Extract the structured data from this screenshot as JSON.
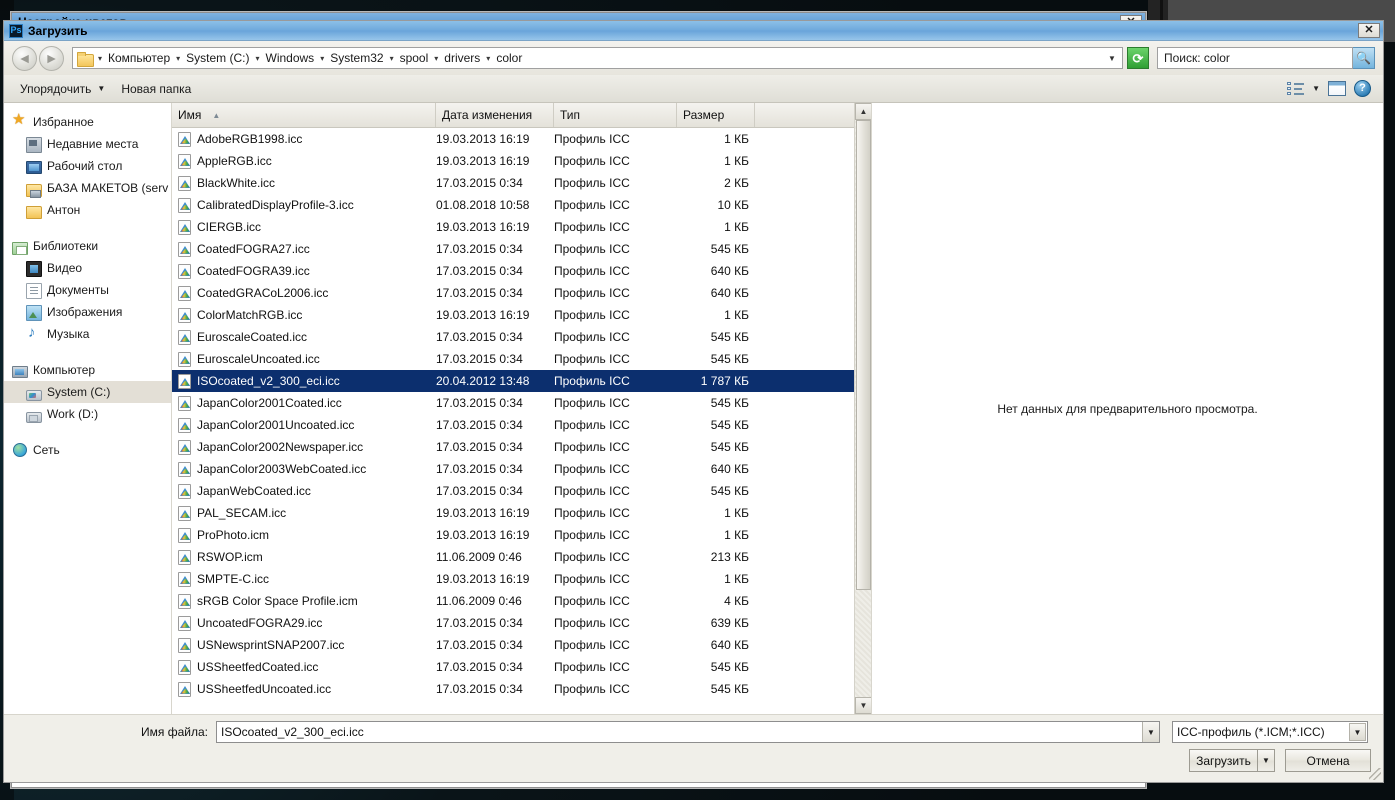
{
  "outer_window": {
    "title": "Настройка цветов",
    "close_label": "✕"
  },
  "dialog": {
    "title": "Загрузить",
    "app_icon": "Ps",
    "close_label": "✕"
  },
  "nav": {
    "back_icon": "◄",
    "forward_icon": "►",
    "folder_icon": "folder-icon",
    "breadcrumb": [
      "Компьютер",
      "System (C:)",
      "Windows",
      "System32",
      "spool",
      "drivers",
      "color"
    ],
    "separator": "▾",
    "refresh_icon": "⟳",
    "search_value": "Поиск: color",
    "search_icon": "🔍"
  },
  "toolbar": {
    "organize_label": "Упорядочить",
    "new_folder_label": "Новая папка",
    "caret": "▼",
    "views_icon": "views-icon",
    "preview_pane_icon": "preview-pane-icon",
    "help_icon": "?"
  },
  "sidebar": {
    "groups": [
      {
        "header": {
          "label": "Избранное",
          "icon": "star"
        },
        "items": [
          {
            "label": "Недавние места",
            "icon": "recent"
          },
          {
            "label": "Рабочий стол",
            "icon": "desktop-i"
          },
          {
            "label": "БАЗА МАКЕТОВ (serv",
            "icon": "netfolder"
          },
          {
            "label": "Антон",
            "icon": "folder-y"
          }
        ]
      },
      {
        "header": {
          "label": "Библиотеки",
          "icon": "library"
        },
        "items": [
          {
            "label": "Видео",
            "icon": "video"
          },
          {
            "label": "Документы",
            "icon": "docs"
          },
          {
            "label": "Изображения",
            "icon": "pics"
          },
          {
            "label": "Музыка",
            "icon": "music"
          }
        ]
      },
      {
        "header": {
          "label": "Компьютер",
          "icon": "computer"
        },
        "items": [
          {
            "label": "System (C:)",
            "icon": "drive-c",
            "selected": true
          },
          {
            "label": "Work (D:)",
            "icon": "drive-d"
          }
        ]
      },
      {
        "header": {
          "label": "Сеть",
          "icon": "network"
        },
        "items": []
      }
    ]
  },
  "filelist": {
    "columns": [
      {
        "label": "Имя",
        "sorted": true,
        "sort_arrow": "▲"
      },
      {
        "label": "Дата изменения"
      },
      {
        "label": "Тип"
      },
      {
        "label": "Размер"
      },
      {
        "label": ""
      }
    ],
    "rows": [
      {
        "name": "AdobeRGB1998.icc",
        "date": "19.03.2013 16:19",
        "type": "Профиль ICC",
        "size": "1 КБ"
      },
      {
        "name": "AppleRGB.icc",
        "date": "19.03.2013 16:19",
        "type": "Профиль ICC",
        "size": "1 КБ"
      },
      {
        "name": "BlackWhite.icc",
        "date": "17.03.2015 0:34",
        "type": "Профиль ICC",
        "size": "2 КБ"
      },
      {
        "name": "CalibratedDisplayProfile-3.icc",
        "date": "01.08.2018 10:58",
        "type": "Профиль ICC",
        "size": "10 КБ"
      },
      {
        "name": "CIERGB.icc",
        "date": "19.03.2013 16:19",
        "type": "Профиль ICC",
        "size": "1 КБ"
      },
      {
        "name": "CoatedFOGRA27.icc",
        "date": "17.03.2015 0:34",
        "type": "Профиль ICC",
        "size": "545 КБ"
      },
      {
        "name": "CoatedFOGRA39.icc",
        "date": "17.03.2015 0:34",
        "type": "Профиль ICC",
        "size": "640 КБ"
      },
      {
        "name": "CoatedGRACoL2006.icc",
        "date": "17.03.2015 0:34",
        "type": "Профиль ICC",
        "size": "640 КБ"
      },
      {
        "name": "ColorMatchRGB.icc",
        "date": "19.03.2013 16:19",
        "type": "Профиль ICC",
        "size": "1 КБ"
      },
      {
        "name": "EuroscaleCoated.icc",
        "date": "17.03.2015 0:34",
        "type": "Профиль ICC",
        "size": "545 КБ"
      },
      {
        "name": "EuroscaleUncoated.icc",
        "date": "17.03.2015 0:34",
        "type": "Профиль ICC",
        "size": "545 КБ"
      },
      {
        "name": "ISOcoated_v2_300_eci.icc",
        "date": "20.04.2012 13:48",
        "type": "Профиль ICC",
        "size": "1 787 КБ",
        "selected": true
      },
      {
        "name": "JapanColor2001Coated.icc",
        "date": "17.03.2015 0:34",
        "type": "Профиль ICC",
        "size": "545 КБ"
      },
      {
        "name": "JapanColor2001Uncoated.icc",
        "date": "17.03.2015 0:34",
        "type": "Профиль ICC",
        "size": "545 КБ"
      },
      {
        "name": "JapanColor2002Newspaper.icc",
        "date": "17.03.2015 0:34",
        "type": "Профиль ICC",
        "size": "545 КБ"
      },
      {
        "name": "JapanColor2003WebCoated.icc",
        "date": "17.03.2015 0:34",
        "type": "Профиль ICC",
        "size": "640 КБ"
      },
      {
        "name": "JapanWebCoated.icc",
        "date": "17.03.2015 0:34",
        "type": "Профиль ICC",
        "size": "545 КБ"
      },
      {
        "name": "PAL_SECAM.icc",
        "date": "19.03.2013 16:19",
        "type": "Профиль ICC",
        "size": "1 КБ"
      },
      {
        "name": "ProPhoto.icm",
        "date": "19.03.2013 16:19",
        "type": "Профиль ICC",
        "size": "1 КБ"
      },
      {
        "name": "RSWOP.icm",
        "date": "11.06.2009 0:46",
        "type": "Профиль ICC",
        "size": "213 КБ"
      },
      {
        "name": "SMPTE-C.icc",
        "date": "19.03.2013 16:19",
        "type": "Профиль ICC",
        "size": "1 КБ"
      },
      {
        "name": "sRGB Color Space Profile.icm",
        "date": "11.06.2009 0:46",
        "type": "Профиль ICC",
        "size": "4 КБ"
      },
      {
        "name": "UncoatedFOGRA29.icc",
        "date": "17.03.2015 0:34",
        "type": "Профиль ICC",
        "size": "639 КБ"
      },
      {
        "name": "USNewsprintSNAP2007.icc",
        "date": "17.03.2015 0:34",
        "type": "Профиль ICC",
        "size": "640 КБ"
      },
      {
        "name": "USSheetfedCoated.icc",
        "date": "17.03.2015 0:34",
        "type": "Профиль ICC",
        "size": "545 КБ"
      },
      {
        "name": "USSheetfedUncoated.icc",
        "date": "17.03.2015 0:34",
        "type": "Профиль ICC",
        "size": "545 КБ"
      }
    ],
    "scroll_up_icon": "▲",
    "scroll_down_icon": "▼"
  },
  "preview": {
    "empty_message": "Нет данных для предварительного просмотра."
  },
  "bottom": {
    "filename_label": "Имя файла:",
    "filename_value": "ISOcoated_v2_300_eci.icc",
    "filetype_value": "ICC-профиль (*.ICM;*.ICC)",
    "dropdown_caret": "▼",
    "load_button": "Загрузить",
    "load_caret": "▼",
    "cancel_button": "Отмена"
  },
  "colors": {
    "selection_blue": "#0c2f6e",
    "title_blue": "#6fa9dc",
    "chrome": "#f0efe9"
  }
}
